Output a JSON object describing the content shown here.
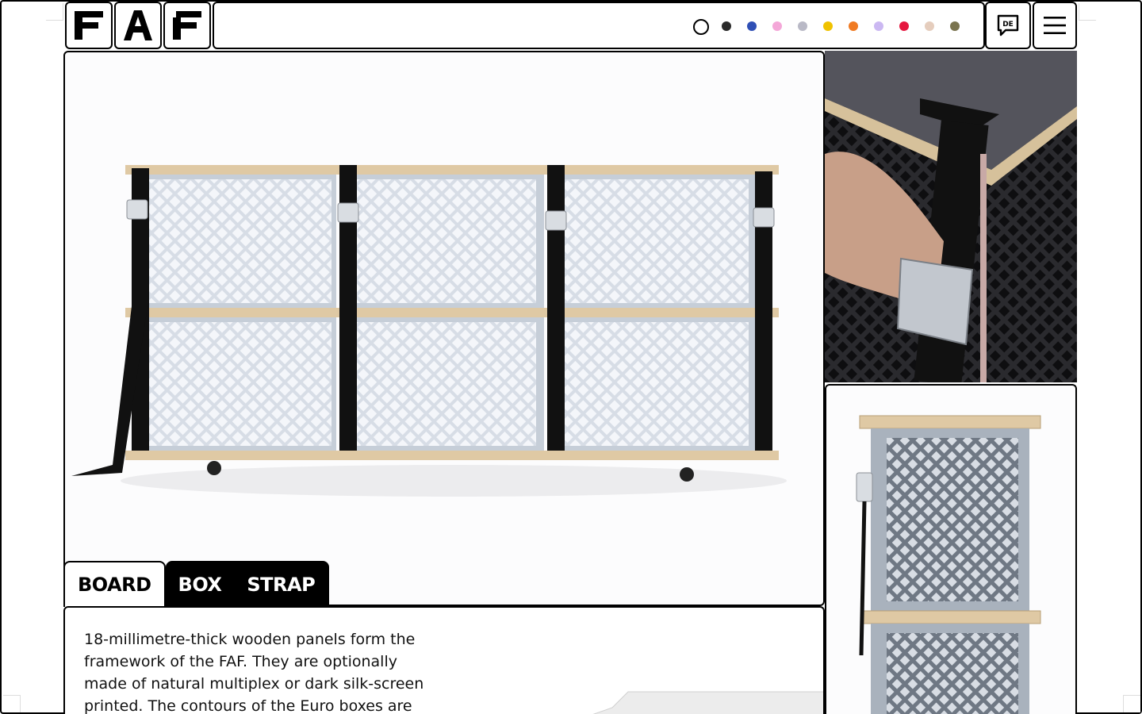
{
  "header": {
    "logo_letters": [
      "F",
      "A",
      "F"
    ],
    "color_swatches": [
      "#ffffff",
      "#2b2b2b",
      "#2f4fb5",
      "#f4a7d8",
      "#b9b9c6",
      "#f0c200",
      "#f07a22",
      "#cbb8f2",
      "#e5173f",
      "#e5cdbd",
      "#7a744f"
    ],
    "language_label": "DE"
  },
  "product_tabs": [
    "BOARD",
    "BOX",
    "STRAP"
  ],
  "active_tab": "BOARD",
  "description": "18-millimetre-thick wooden panels form the framework of the FAF. They are optionally made of natural multiplex or dark silk-screen printed. The contours of the Euro boxes are"
}
